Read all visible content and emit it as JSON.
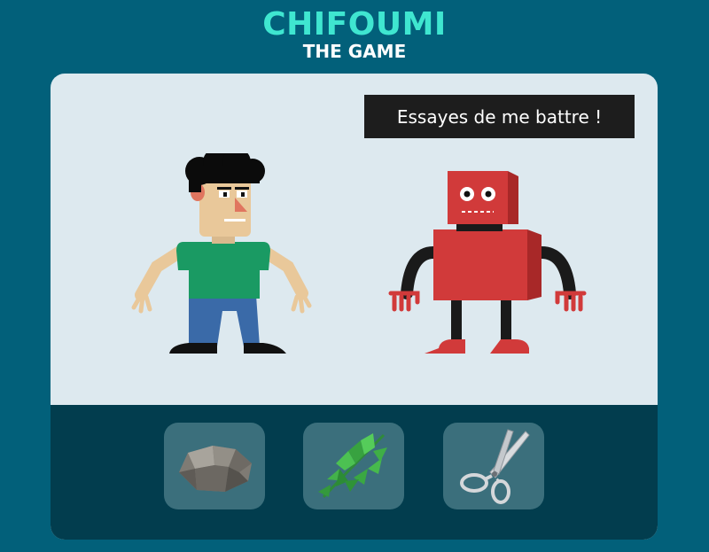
{
  "header": {
    "title": "CHIFOUMI",
    "subtitle": "THE GAME"
  },
  "game": {
    "opponent_message": "Essayes de me battre !",
    "choices": [
      {
        "name": "rock",
        "icon": "rock-icon"
      },
      {
        "name": "leaf",
        "icon": "leaf-icon"
      },
      {
        "name": "scissors",
        "icon": "scissors-icon"
      }
    ]
  },
  "colors": {
    "background": "#02607a",
    "title": "#3fe6d0",
    "card": "#dde9ef",
    "tray": "#023d4e",
    "choice_button": "#3b6f7c",
    "robot": "#d13a3a",
    "shirt": "#1a9a63",
    "jeans": "#3a6aa8"
  }
}
